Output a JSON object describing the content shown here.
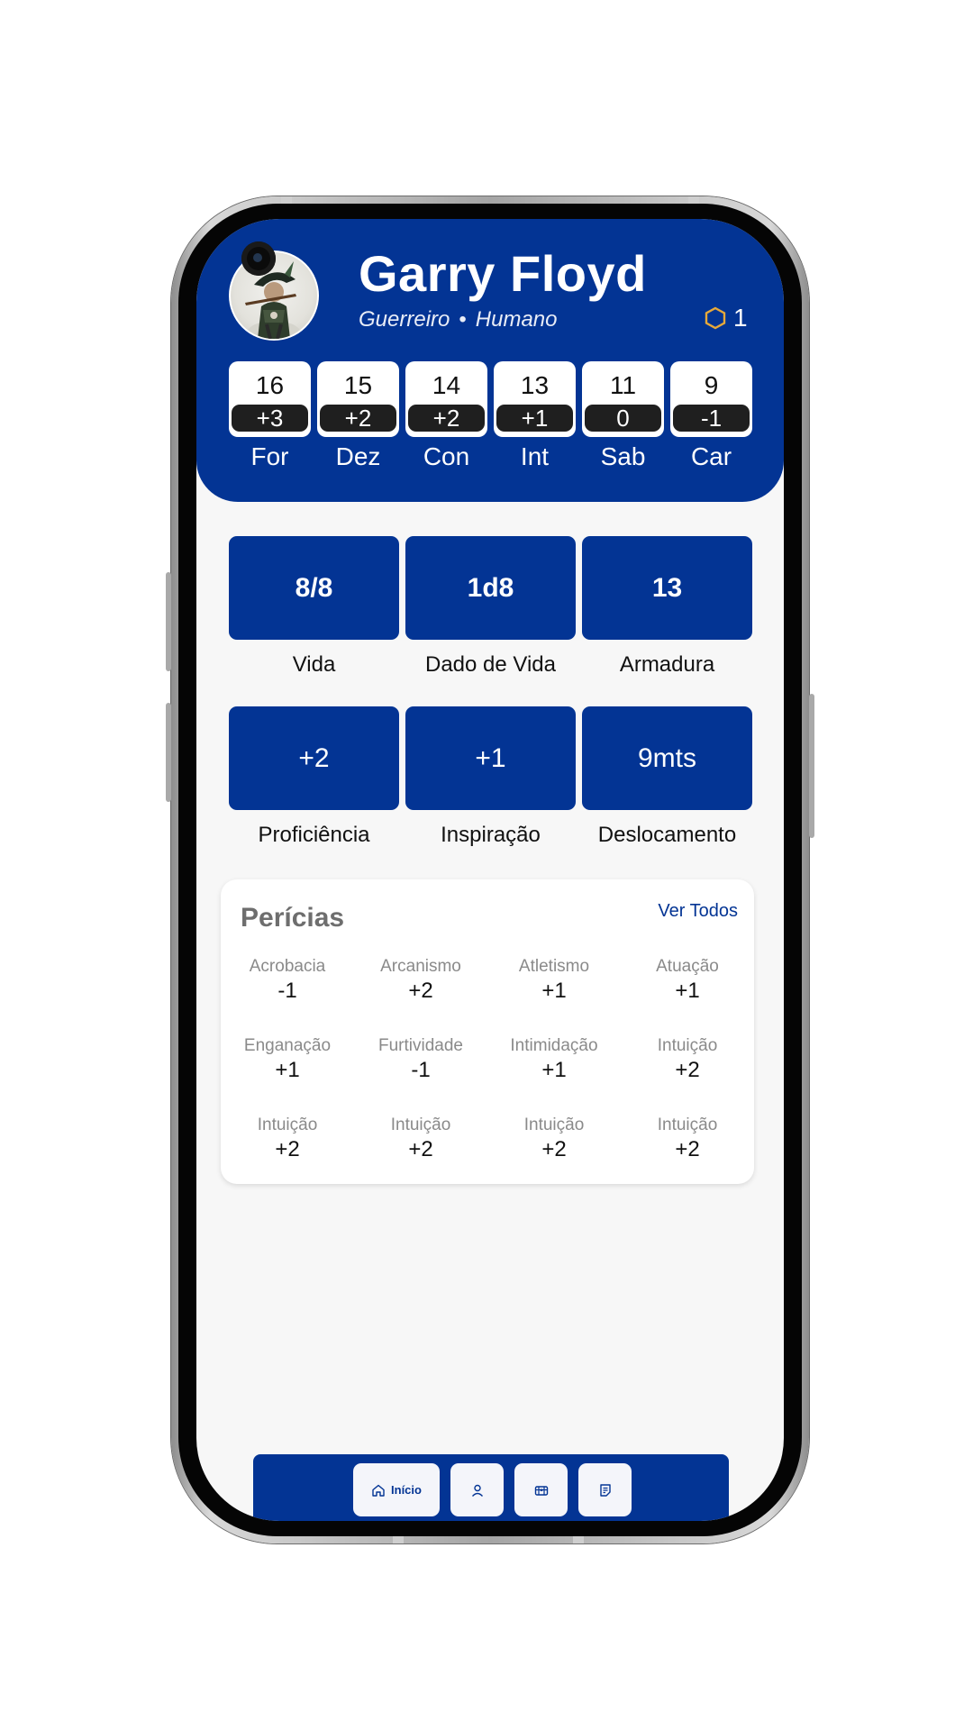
{
  "character": {
    "name": "Garry Floyd",
    "class": "Guerreiro",
    "separator": "•",
    "race": "Humano",
    "level": "1"
  },
  "attributes": [
    {
      "label": "For",
      "value": "16",
      "modifier": "+3"
    },
    {
      "label": "Dez",
      "value": "15",
      "modifier": "+2"
    },
    {
      "label": "Con",
      "value": "14",
      "modifier": "+2"
    },
    {
      "label": "Int",
      "value": "13",
      "modifier": "+1"
    },
    {
      "label": "Sab",
      "value": "11",
      "modifier": "0"
    },
    {
      "label": "Car",
      "value": "9",
      "modifier": "-1"
    }
  ],
  "vitals": [
    {
      "label": "Vida",
      "value": "8/8"
    },
    {
      "label": "Dado de Vida",
      "value": "1d8"
    },
    {
      "label": "Armadura",
      "value": "13"
    }
  ],
  "bonuses": [
    {
      "label": "Proficiência",
      "value": "+2"
    },
    {
      "label": "Inspiração",
      "value": "+1"
    },
    {
      "label": "Deslocamento",
      "value": "9mts"
    }
  ],
  "skills": {
    "title": "Perícias",
    "see_all": "Ver Todos",
    "items": [
      {
        "name": "Acrobacia",
        "value": "-1"
      },
      {
        "name": "Arcanismo",
        "value": "+2"
      },
      {
        "name": "Atletismo",
        "value": "+1"
      },
      {
        "name": "Atuação",
        "value": "+1"
      },
      {
        "name": "Enganação",
        "value": "+1"
      },
      {
        "name": "Furtividade",
        "value": "-1"
      },
      {
        "name": "Intimidação",
        "value": "+1"
      },
      {
        "name": "Intuição",
        "value": "+2"
      },
      {
        "name": "Intuição",
        "value": "+2"
      },
      {
        "name": "Intuição",
        "value": "+2"
      },
      {
        "name": "Intuição",
        "value": "+2"
      },
      {
        "name": "Intuição",
        "value": "+2"
      }
    ]
  },
  "nav": {
    "home_label": "Início",
    "items": [
      "home-icon",
      "user-icon",
      "inventory-icon",
      "notes-icon"
    ]
  },
  "colors": {
    "primary": "#033494",
    "level_icon": "#e7a93a",
    "background": "#f7f7f7"
  }
}
